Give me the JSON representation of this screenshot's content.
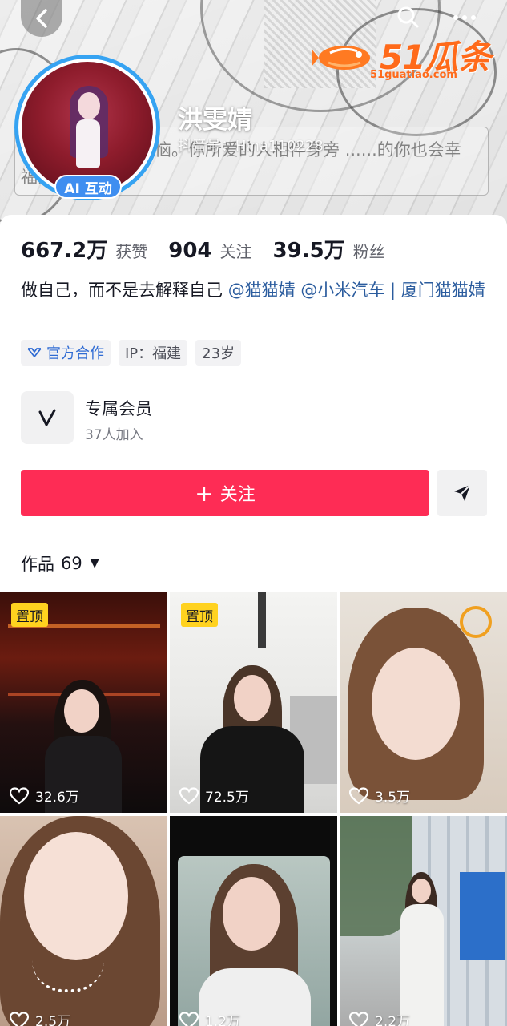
{
  "header": {
    "nickname": "洪雯婧",
    "douyin_id": "抖音号：Hina110228",
    "signature_bg": "...竞争，就是，烦恼。你所爱的人相伴身旁 ......的你也会幸福的。",
    "ai_badge": "AI 互动",
    "watermark_main": "51瓜条",
    "watermark_sub": "51guatiao.com"
  },
  "stats": [
    {
      "value": "667.2万",
      "label": "获赞"
    },
    {
      "value": "904",
      "label": "关注"
    },
    {
      "value": "39.5万",
      "label": "粉丝"
    }
  ],
  "bio": {
    "text": "做自己，而不是去解释自己",
    "mentions": "@猫猫婧 @小米汽车 | 厦门猫猫婧"
  },
  "tags": [
    {
      "label": "官方合作"
    },
    {
      "label": "IP：福建"
    },
    {
      "label": "23岁"
    }
  ],
  "vip": {
    "title": "专属会员",
    "subtitle": "37人加入"
  },
  "actions": {
    "follow_label": "关注",
    "follow_plus": "+"
  },
  "works": {
    "label": "作品",
    "count": "69"
  },
  "videos": [
    {
      "pinned": "置顶",
      "likes": "32.6万"
    },
    {
      "pinned": "置顶",
      "likes": "72.5万"
    },
    {
      "pinned": "",
      "likes": "3.5万"
    },
    {
      "pinned": "",
      "likes": "2.5万"
    },
    {
      "pinned": "",
      "likes": "1.2万"
    },
    {
      "pinned": "",
      "likes": "2.2万"
    }
  ],
  "colors": {
    "accent": "#fe2c55",
    "avatar_ring": "#36a3f2",
    "mention": "#2b5c9e",
    "pin": "#ffd21f"
  }
}
